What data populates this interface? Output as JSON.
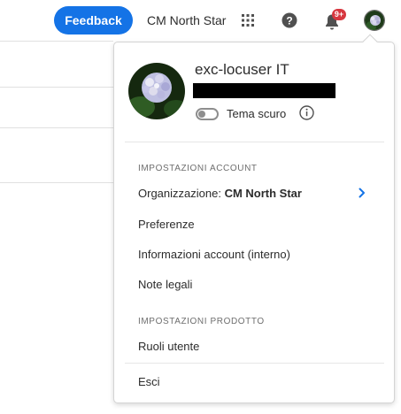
{
  "topbar": {
    "feedback_label": "Feedback",
    "org_name": "CM North Star",
    "notification_badge": "9+",
    "icons": [
      "apps-grid-icon",
      "help-icon",
      "bell-icon",
      "user-avatar"
    ]
  },
  "profile": {
    "user_name": "exc-locuser IT",
    "dark_mode_label": "Tema scuro",
    "dark_mode_enabled": false
  },
  "account_section": {
    "title": "IMPOSTAZIONI ACCOUNT",
    "org_prefix": "Organizzazione:",
    "org_value": "CM North Star",
    "preferences": "Preferenze",
    "account_info": "Informazioni account (interno)",
    "legal": "Note legali"
  },
  "product_section": {
    "title": "IMPOSTAZIONI PRODOTTO",
    "user_roles": "Ruoli utente"
  },
  "signout_label": "Esci",
  "colors": {
    "accent": "#1473e6",
    "badge": "#d7373f"
  }
}
